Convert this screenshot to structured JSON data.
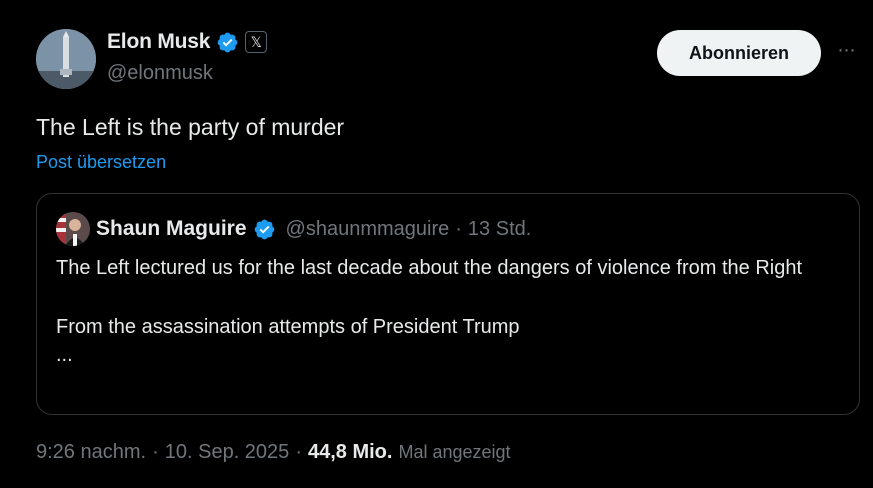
{
  "author": {
    "name": "Elon Musk",
    "handle": "@elonmusk",
    "affiliate_badge": "𝕏"
  },
  "follow_button": "Abonnieren",
  "more_icon": "⋯",
  "tweet": {
    "text": "The Left is the party of murder",
    "translate_link": "Post übersetzen"
  },
  "quoted": {
    "name": "Shaun Maguire",
    "handle": "@shaunmmaguire",
    "separator": "·",
    "time": "13 Std.",
    "line1": "The Left lectured us for the last decade about the dangers of violence from the Right",
    "line2": "From the assassination attempts of President Trump",
    "ellipsis": "..."
  },
  "meta": {
    "time": "9:26 nachm.",
    "sep1": "·",
    "date": "10. Sep. 2025",
    "sep2": "·",
    "views": "44,8 Mio.",
    "views_label": "Mal angezeigt"
  },
  "colors": {
    "background": "#000000",
    "text": "#e7e9ea",
    "muted": "#71767b",
    "link": "#1d9bf0",
    "verified": "#1d9bf0",
    "border": "#2f3336"
  }
}
